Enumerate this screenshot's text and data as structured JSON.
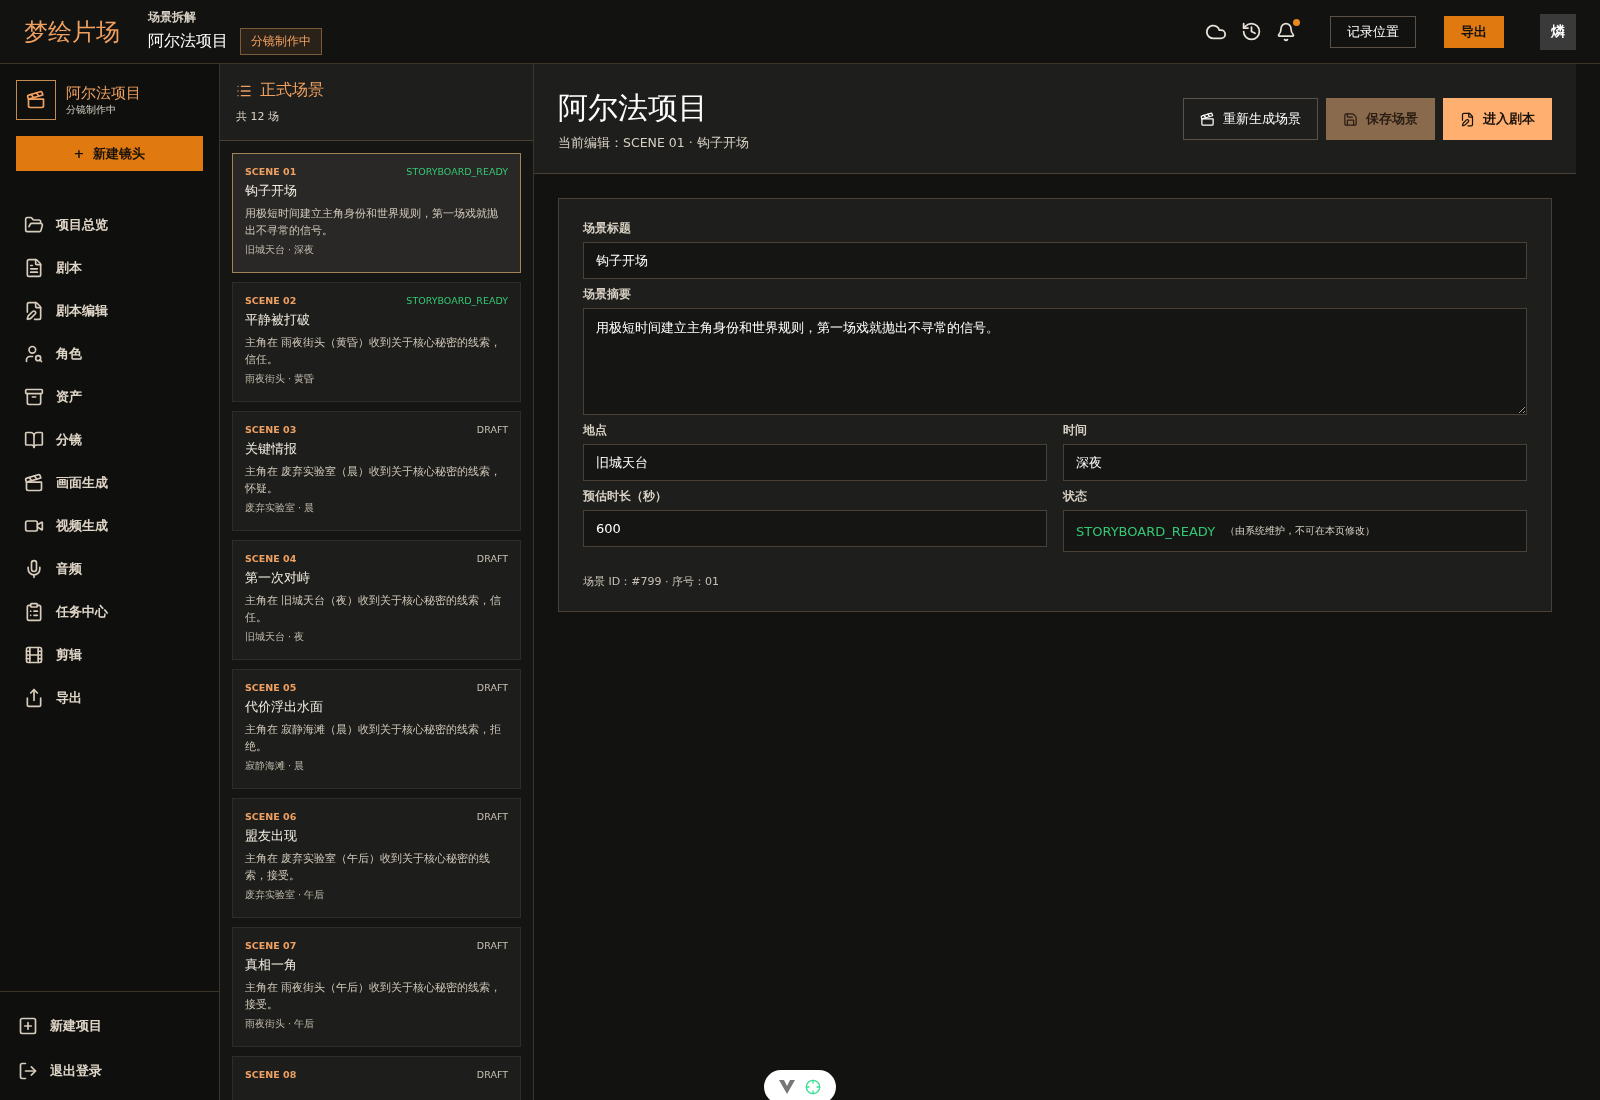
{
  "topbar": {
    "brand": "梦绘片场",
    "breadcrumb": "场景拆解",
    "project": "阿尔法项目",
    "badge": "分镜制作中",
    "notification_dot": true,
    "buttons": [
      {
        "label": "记录位置",
        "kind": "outline"
      },
      {
        "label": "导出",
        "kind": "primary"
      }
    ],
    "avatar": "燐"
  },
  "sidebar": {
    "project": {
      "name": "阿尔法项目",
      "status": "分镜制作中"
    },
    "new_button": "+  新建镜头",
    "items": [
      {
        "label": "项目总览",
        "selected": false
      },
      {
        "label": "剧本",
        "selected": false
      },
      {
        "label": "剧本编辑",
        "selected": false
      },
      {
        "label": "角色",
        "selected": false
      },
      {
        "label": "资产",
        "selected": false
      },
      {
        "label": "分镜",
        "selected": false
      },
      {
        "label": "画面生成",
        "selected": false
      },
      {
        "label": "视频生成",
        "selected": false
      },
      {
        "label": "音频",
        "selected": false
      },
      {
        "label": "任务中心",
        "selected": false
      },
      {
        "label": "剪辑",
        "selected": false
      },
      {
        "label": "导出",
        "selected": false
      }
    ],
    "footer": [
      {
        "label": "新建项目"
      },
      {
        "label": "退出登录"
      }
    ]
  },
  "scene_list": {
    "title": "正式场景",
    "count": "共 12 场",
    "scenes": [
      {
        "code": "SCENE 01",
        "status": "STORYBOARD_READY",
        "kind": "ready",
        "selected": true,
        "title": "钩子开场",
        "summary": "用极短时间建立主角身份和世界规则，第一场戏就抛出不寻常的信号。",
        "meta": "旧城天台 · 深夜"
      },
      {
        "code": "SCENE 02",
        "status": "STORYBOARD_READY",
        "kind": "ready",
        "selected": false,
        "title": "平静被打破",
        "summary": "主角在 雨夜街头（黄昏）收到关于核心秘密的线索，信任。",
        "meta": "雨夜街头 · 黄昏"
      },
      {
        "code": "SCENE 03",
        "status": "DRAFT",
        "kind": "draft",
        "selected": false,
        "title": "关键情报",
        "summary": "主角在 废弃实验室（晨）收到关于核心秘密的线索，怀疑。",
        "meta": "废弃实验室 · 晨"
      },
      {
        "code": "SCENE 04",
        "status": "DRAFT",
        "kind": "draft",
        "selected": false,
        "title": "第一次对峙",
        "summary": "主角在 旧城天台（夜）收到关于核心秘密的线索，信任。",
        "meta": "旧城天台 · 夜"
      },
      {
        "code": "SCENE 05",
        "status": "DRAFT",
        "kind": "draft",
        "selected": false,
        "title": "代价浮出水面",
        "summary": "主角在 寂静海滩（晨）收到关于核心秘密的线索，拒绝。",
        "meta": "寂静海滩 · 晨"
      },
      {
        "code": "SCENE 06",
        "status": "DRAFT",
        "kind": "draft",
        "selected": false,
        "title": "盟友出现",
        "summary": "主角在 废弃实验室（午后）收到关于核心秘密的线索，接受。",
        "meta": "废弃实验室 · 午后"
      },
      {
        "code": "SCENE 07",
        "status": "DRAFT",
        "kind": "draft",
        "selected": false,
        "title": "真相一角",
        "summary": "主角在 雨夜街头（午后）收到关于核心秘密的线索，接受。",
        "meta": "雨夜街头 · 午后"
      },
      {
        "code": "SCENE 08",
        "status": "DRAFT",
        "kind": "draft",
        "selected": false
      }
    ]
  },
  "editor": {
    "title": "阿尔法项目",
    "subtitle": "当前编辑：SCENE 01 · 钩子开场",
    "actions": [
      {
        "label": "重新生成场景",
        "kind": "outline"
      },
      {
        "label": "保存场景",
        "kind": "muted"
      },
      {
        "label": "进入剧本",
        "kind": "primary"
      }
    ],
    "form": {
      "title_label": "场景标题",
      "title_value": "钩子开场",
      "summary_label": "场景摘要",
      "summary_value": "用极短时间建立主角身份和世界规则，第一场戏就抛出不寻常的信号。",
      "location_label": "地点",
      "location_value": "旧城天台",
      "time_label": "时间",
      "time_value": "深夜",
      "duration_label": "预估时长（秒）",
      "duration_value": "600",
      "status_label": "状态",
      "status_value": "STORYBOARD_READY",
      "status_note": "（由系统维护，不可在本页修改）",
      "footnote": "场景 ID：#799 · 序号：01"
    }
  }
}
